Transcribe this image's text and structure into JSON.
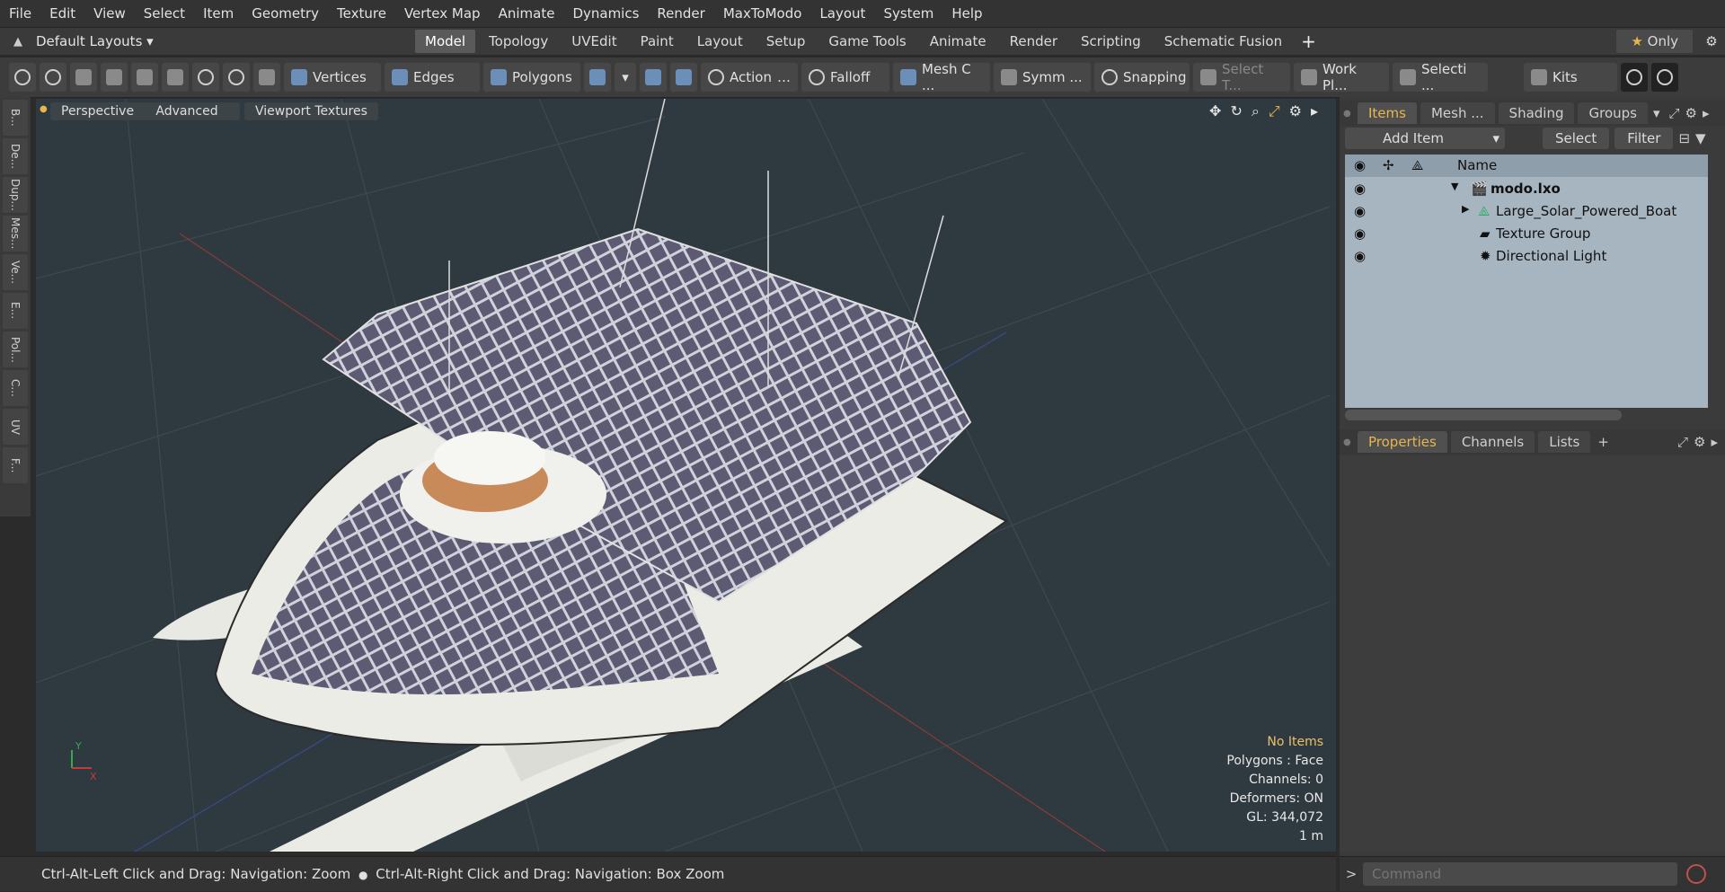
{
  "menu": [
    "File",
    "Edit",
    "View",
    "Select",
    "Item",
    "Geometry",
    "Texture",
    "Vertex Map",
    "Animate",
    "Dynamics",
    "Render",
    "MaxToModo",
    "Layout",
    "System",
    "Help"
  ],
  "layout_preset": "Default Layouts",
  "layout_tabs": [
    {
      "label": "Model",
      "active": true
    },
    {
      "label": "Topology",
      "active": false
    },
    {
      "label": "UVEdit",
      "active": false
    },
    {
      "label": "Paint",
      "active": false
    },
    {
      "label": "Layout",
      "active": false
    },
    {
      "label": "Setup",
      "active": false
    },
    {
      "label": "Game Tools",
      "active": false
    },
    {
      "label": "Animate",
      "active": false
    },
    {
      "label": "Render",
      "active": false
    },
    {
      "label": "Scripting",
      "active": false
    },
    {
      "label": "Schematic Fusion",
      "active": false
    }
  ],
  "only_label": "Only",
  "toolbar": {
    "vertices": "Vertices",
    "edges": "Edges",
    "polygons": "Polygons",
    "action": "Action",
    "falloff": "Falloff",
    "mesh": "Mesh C ...",
    "symmetry": "Symm ...",
    "snapping": "Snapping",
    "select_t": "Select T...",
    "workplane": "Work Pl...",
    "selection": "Selecti ...",
    "kits": "Kits"
  },
  "left_tabs": [
    "B...",
    "De...",
    "Dup...",
    "Mes...",
    "Ve...",
    "E...",
    "Pol...",
    "C...",
    "UV",
    "F..."
  ],
  "viewport": {
    "buttons": [
      "Perspective",
      "Advanced",
      "Viewport Textures"
    ],
    "stats": {
      "selection": "No Items",
      "polygons": "Polygons : Face",
      "channels": "Channels: 0",
      "deformers": "Deformers: ON",
      "gl": "GL: 344,072",
      "scale": "1 m"
    }
  },
  "status": {
    "part1": "Ctrl-Alt-Left Click and Drag: Navigation: Zoom",
    "part2": "Ctrl-Alt-Right Click and Drag: Navigation: Box Zoom"
  },
  "items_panel": {
    "tabs": [
      {
        "label": "Items",
        "active": true
      },
      {
        "label": "Mesh ...",
        "active": false
      },
      {
        "label": "Shading",
        "active": false
      },
      {
        "label": "Groups",
        "active": false
      }
    ],
    "add_item": "Add Item",
    "select": "Select",
    "filter": "Filter",
    "name_header": "Name",
    "rows": [
      "modo.lxo",
      "Large_Solar_Powered_Boat",
      "Texture Group",
      "Directional Light"
    ]
  },
  "props_panel": {
    "tabs": [
      {
        "label": "Properties",
        "active": true
      },
      {
        "label": "Channels",
        "active": false
      },
      {
        "label": "Lists",
        "active": false
      }
    ]
  },
  "command": {
    "placeholder": "Command"
  }
}
